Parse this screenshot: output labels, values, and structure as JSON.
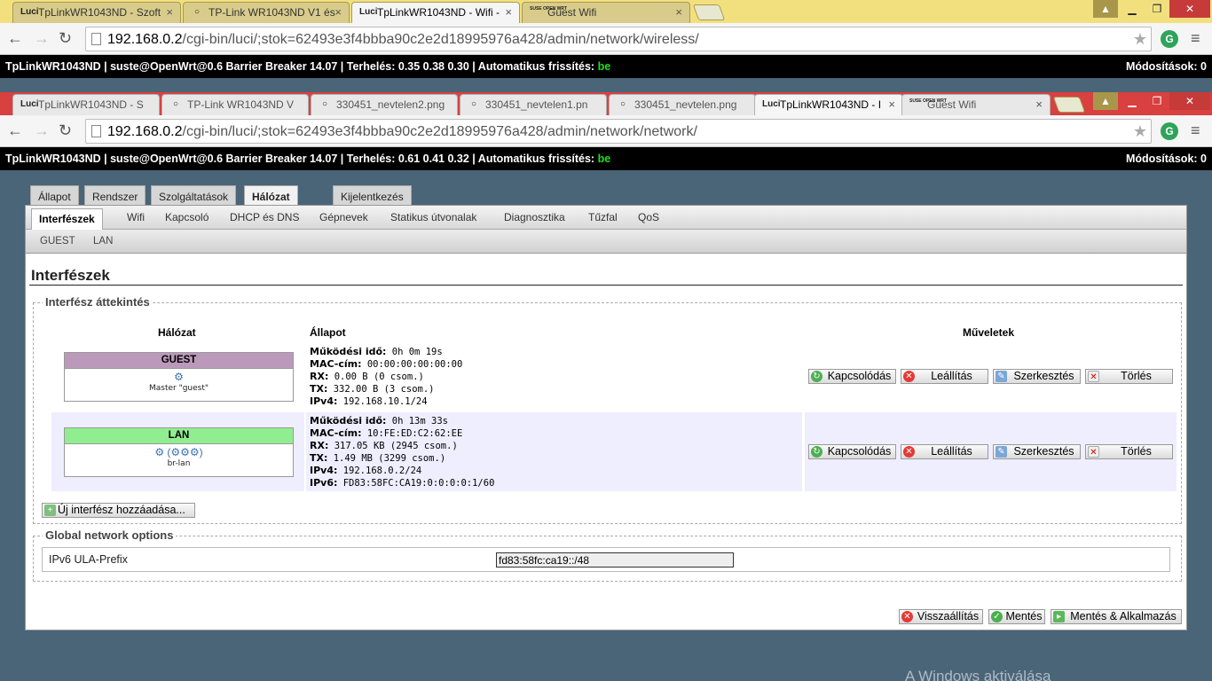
{
  "window1": {
    "tabs": [
      {
        "label": "TpLinkWR1043ND - Szoft",
        "icon": "luci-icon"
      },
      {
        "label": "TP-Link WR1043ND V1 és",
        "icon": "search-icon"
      },
      {
        "label": "TpLinkWR1043ND - Wifi -",
        "icon": "luci-icon",
        "active": true
      },
      {
        "label": "Guest Wifi",
        "icon": "suse-icon"
      }
    ],
    "url_host": "192.168.0.2",
    "url_path": "/cgi-bin/luci/;stok=62493e3f4bbba90c2e2d18995976a428/admin/network/wireless/",
    "header": {
      "text": "TpLinkWR1043ND | suste@OpenWrt@0.6 Barrier Breaker 14.07 | Terhelés: 0.35 0.38 0.30 | Automatikus frissítés:",
      "refresh": "be",
      "changes": "Módosítások: 0"
    }
  },
  "window2": {
    "tabs": [
      {
        "label": "TpLinkWR1043ND - S",
        "icon": "luci-icon"
      },
      {
        "label": "TP-Link WR1043ND V",
        "icon": "search-icon"
      },
      {
        "label": "330451_nevtelen2.png",
        "icon": "search-icon"
      },
      {
        "label": "330451_nevtelen1.pn",
        "icon": "search-icon"
      },
      {
        "label": "330451_nevtelen.png",
        "icon": "search-icon"
      },
      {
        "label": "TpLinkWR1043ND - I",
        "icon": "luci-icon",
        "active": true
      },
      {
        "label": "Guest Wifi",
        "icon": "suse-icon"
      }
    ],
    "url_host": "192.168.0.2",
    "url_path": "/cgi-bin/luci/;stok=62493e3f4bbba90c2e2d18995976a428/admin/network/network/",
    "header": {
      "text": "TpLinkWR1043ND | suste@OpenWrt@0.6 Barrier Breaker 14.07 | Terhelés: 0.61 0.41 0.32 | Automatikus frissítés:",
      "refresh": "be",
      "changes": "Módosítások: 0"
    }
  },
  "icons": {
    "suse": "SUSE OPEN WRT",
    "luci": "Luci"
  },
  "main_tabs": [
    "Állapot",
    "Rendszer",
    "Szolgáltatások",
    "Hálózat",
    "Kijelentkezés"
  ],
  "sub_tabs": [
    "Interfészek",
    "Wifi",
    "Kapcsoló",
    "DHCP és DNS",
    "Gépnevek",
    "Statikus útvonalak",
    "Diagnosztika",
    "Tűzfal",
    "QoS"
  ],
  "iface_tabs": [
    "GUEST",
    "LAN"
  ],
  "page_title": "Interfészek",
  "overview": {
    "legend": "Interfész áttekintés",
    "col_network": "Hálózat",
    "col_status": "Állapot",
    "col_actions": "Műveletek",
    "rows": [
      {
        "name": "GUEST",
        "color": "#bb99bb",
        "icons": "⚙",
        "device": "Master \"guest\"",
        "uptime_label": "Működési idő:",
        "uptime": "0h 0m 19s",
        "mac_label": "MAC-cím:",
        "mac": "00:00:00:00:00:00",
        "rx_label": "RX:",
        "rx": "0.00 B (0 csom.)",
        "tx_label": "TX:",
        "tx": "332.00 B (3 csom.)",
        "ipv4_label": "IPv4:",
        "ipv4": "192.168.10.1/24"
      },
      {
        "name": "LAN",
        "color": "#90ee90",
        "icons": "⚙ (⚙⚙⚙)",
        "device": "br-lan",
        "uptime_label": "Működési idő:",
        "uptime": "0h 13m 33s",
        "mac_label": "MAC-cím:",
        "mac": "10:FE:ED:C2:62:EE",
        "rx_label": "RX:",
        "rx": "317.05 KB (2945 csom.)",
        "tx_label": "TX:",
        "tx": "1.49 MB (3299 csom.)",
        "ipv4_label": "IPv4:",
        "ipv4": "192.168.0.2/24",
        "ipv6_label": "IPv6:",
        "ipv6": "FD83:58FC:CA19:0:0:0:0:1/60"
      }
    ],
    "actions": {
      "connect": "Kapcsolódás",
      "stop": "Leállítás",
      "edit": "Szerkesztés",
      "delete": "Törlés"
    },
    "add_iface": "Új interfész hozzáadása..."
  },
  "global": {
    "legend": "Global network options",
    "ula_label": "IPv6 ULA-Prefix",
    "ula_value": "fd83:58fc:ca19::/48"
  },
  "footer": {
    "reset": "Visszaállítás",
    "save": "Mentés",
    "save_apply": "Mentés & Alkalmazás"
  },
  "watermark": "A Windows aktiválása"
}
